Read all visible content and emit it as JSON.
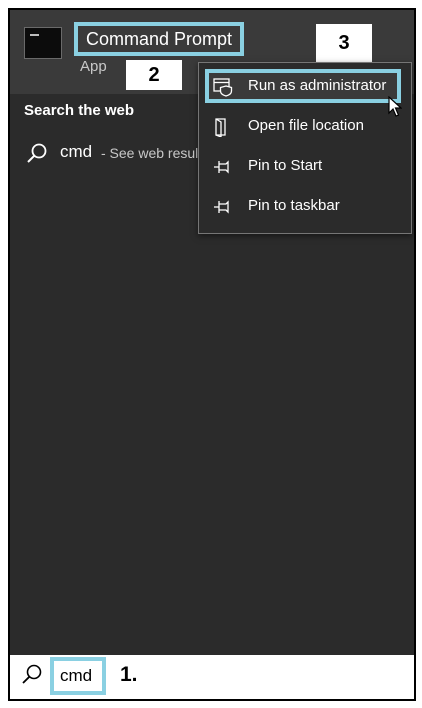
{
  "top_result": {
    "title": "Command Prompt",
    "subtitle": "App",
    "icon": "terminal-app-icon"
  },
  "section": {
    "header": "Search the web"
  },
  "web_result": {
    "term": "cmd",
    "hint": "- See web results"
  },
  "context_menu": {
    "items": [
      {
        "label": "Run as administrator",
        "icon": "shield-run-icon"
      },
      {
        "label": "Open file location",
        "icon": "folder-open-icon"
      },
      {
        "label": "Pin to Start",
        "icon": "pin-icon"
      },
      {
        "label": "Pin to taskbar",
        "icon": "pin-icon"
      }
    ]
  },
  "taskbar": {
    "search_value": "cmd",
    "icon": "search-icon"
  },
  "annotations": {
    "step1": "1.",
    "step2": "2",
    "step3": "3"
  },
  "colors": {
    "menu_background": "#2b2b2b",
    "top_result_background": "#3a3a3a",
    "highlight_border": "#8ad0e2",
    "text": "#ffffff"
  }
}
